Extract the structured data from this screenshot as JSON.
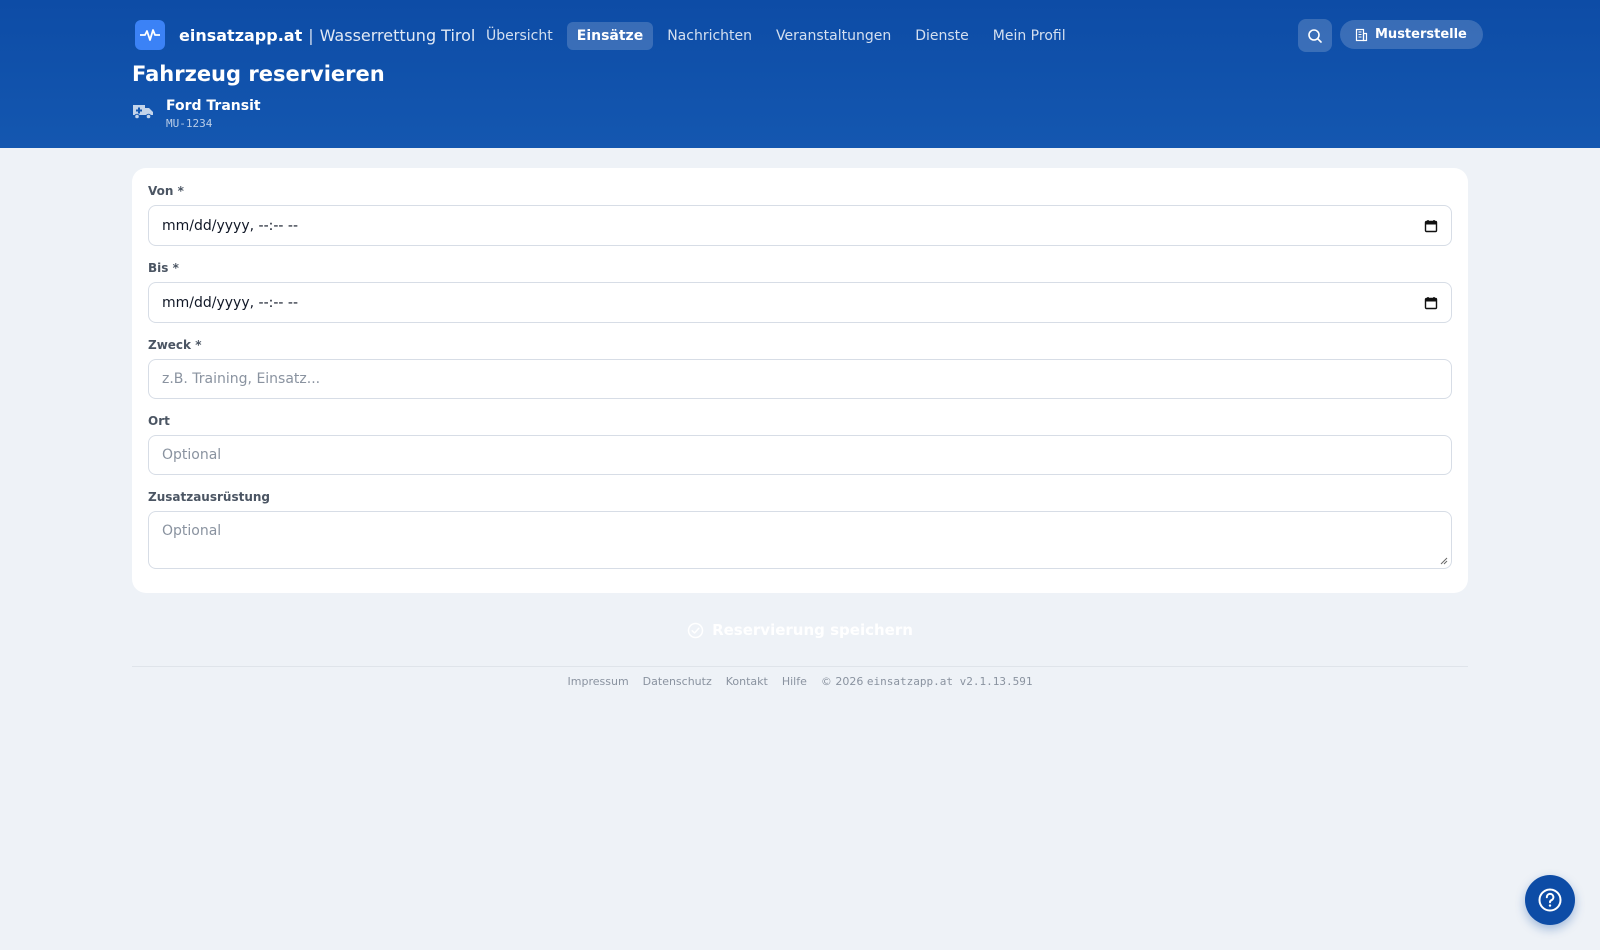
{
  "brand": {
    "name": "einsatzapp.at",
    "separator": "|",
    "organization": "Wasserrettung Tirol",
    "logo_icon": "heartbeat-icon"
  },
  "nav": {
    "items": [
      {
        "label": "Übersicht",
        "active": false
      },
      {
        "label": "Einsätze",
        "active": true
      },
      {
        "label": "Nachrichten",
        "active": false
      },
      {
        "label": "Veranstaltungen",
        "active": false
      },
      {
        "label": "Dienste",
        "active": false
      },
      {
        "label": "Mein Profil",
        "active": false
      }
    ]
  },
  "header_actions": {
    "search_icon": "search-icon",
    "org_label": "Musterstelle",
    "org_icon": "building-icon"
  },
  "page": {
    "title": "Fahrzeug reservieren",
    "vehicle_name": "Ford Transit",
    "vehicle_plate": "MU-1234",
    "vehicle_icon": "ambulance-icon"
  },
  "form": {
    "von_label": "Von *",
    "von_value": "mm/dd/yyyy, --:-- --",
    "bis_label": "Bis *",
    "bis_value": "mm/dd/yyyy, --:-- --",
    "zweck_label": "Zweck *",
    "zweck_placeholder": "z.B. Training, Einsatz...",
    "ort_label": "Ort",
    "ort_placeholder": "Optional",
    "zusatz_label": "Zusatzausrüstung",
    "zusatz_placeholder": "Optional",
    "save_label": "Reservierung speichern"
  },
  "footer": {
    "links": [
      "Impressum",
      "Datenschutz",
      "Kontakt",
      "Hilfe"
    ],
    "copyright": "© 2026",
    "version": "einsatzapp.at v2.1.13.591"
  },
  "colors": {
    "header": "#0d4ca6",
    "background": "#eef2f7",
    "accent": "#3b82f6"
  }
}
